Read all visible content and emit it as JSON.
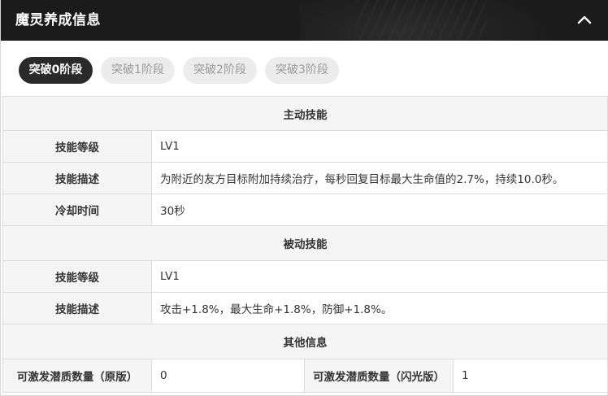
{
  "header": {
    "title": "魔灵养成信息",
    "collapse_icon": "chevron-up-icon"
  },
  "tabs": [
    {
      "label": "突破0阶段",
      "active": true
    },
    {
      "label": "突破1阶段",
      "active": false
    },
    {
      "label": "突破2阶段",
      "active": false
    },
    {
      "label": "突破3阶段",
      "active": false
    }
  ],
  "active_skill": {
    "title": "主动技能",
    "rows": [
      {
        "label": "技能等级",
        "value": "LV1"
      },
      {
        "label": "技能描述",
        "value": "为附近的友方目标附加持续治疗，每秒回复目标最大生命值的2.7%，持续10.0秒。"
      },
      {
        "label": "冷却时间",
        "value": "30秒"
      }
    ]
  },
  "passive_skill": {
    "title": "被动技能",
    "rows": [
      {
        "label": "技能等级",
        "value": "LV1"
      },
      {
        "label": "技能描述",
        "value": "攻击+1.8%，最大生命+1.8%，防御+1.8%。"
      }
    ]
  },
  "other_info": {
    "title": "其他信息",
    "original_label": "可激发潜质数量（原版）",
    "original_value": "0",
    "flash_label": "可激发潜质数量（闪光版）",
    "flash_value": "1"
  }
}
